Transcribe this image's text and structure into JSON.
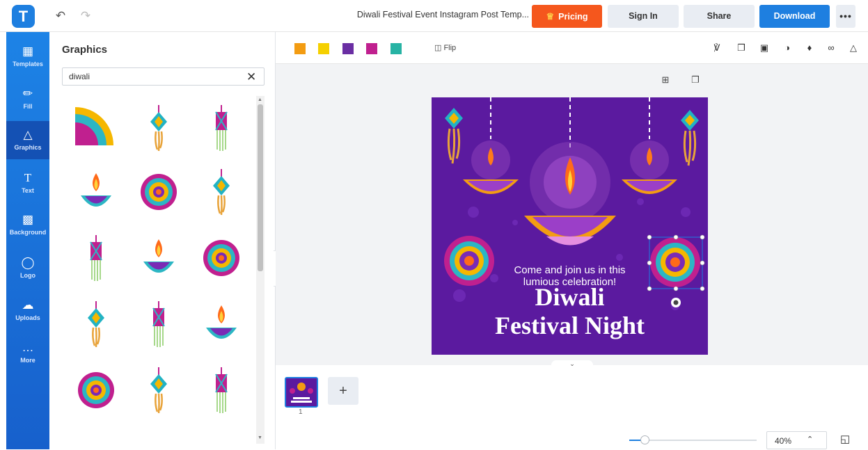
{
  "app": {
    "logo_letter": "T"
  },
  "header": {
    "undo_icon": "undo-icon",
    "redo_icon": "redo-icon",
    "doc_title": "Diwali Festival Event Instagram Post Temp...",
    "pricing_label": "Pricing",
    "signin_label": "Sign In",
    "share_label": "Share",
    "download_label": "Download",
    "more_label": "•••"
  },
  "sidebar": {
    "items": [
      {
        "label": "Templates",
        "icon": "templates-icon"
      },
      {
        "label": "Fill",
        "icon": "pencil-icon"
      },
      {
        "label": "Graphics",
        "icon": "shapes-icon"
      },
      {
        "label": "Text",
        "icon": "text-icon"
      },
      {
        "label": "Background",
        "icon": "background-icon"
      },
      {
        "label": "Logo",
        "icon": "logo-icon"
      },
      {
        "label": "Uploads",
        "icon": "cloud-upload-icon"
      },
      {
        "label": "More",
        "icon": "more-icon"
      }
    ],
    "active": "Graphics"
  },
  "graphics_panel": {
    "title": "Graphics",
    "search_value": "diwali",
    "items": [
      "mandala-corner",
      "lantern",
      "kite-lantern",
      "diya",
      "mandala",
      "lantern",
      "kite-lantern",
      "diya",
      "mandala",
      "lantern",
      "kite-lantern",
      "diya",
      "mandala",
      "lantern",
      "kite-lantern"
    ]
  },
  "toolbar": {
    "colors": [
      "#f39c12",
      "#f5d000",
      "#6a2ea3",
      "#c0208f",
      "#27b3a4"
    ],
    "flip_label": "Flip"
  },
  "canvas": {
    "invite_line1": "Come and join us in this",
    "invite_line2": "lumious celebration!",
    "title_line1": "Diwali",
    "title_line2": "Festival Night",
    "background_color": "#5b1a9f"
  },
  "pages": {
    "current": "1",
    "add_label": "+"
  },
  "zoom": {
    "value_label": "40%",
    "level": 0.12
  }
}
